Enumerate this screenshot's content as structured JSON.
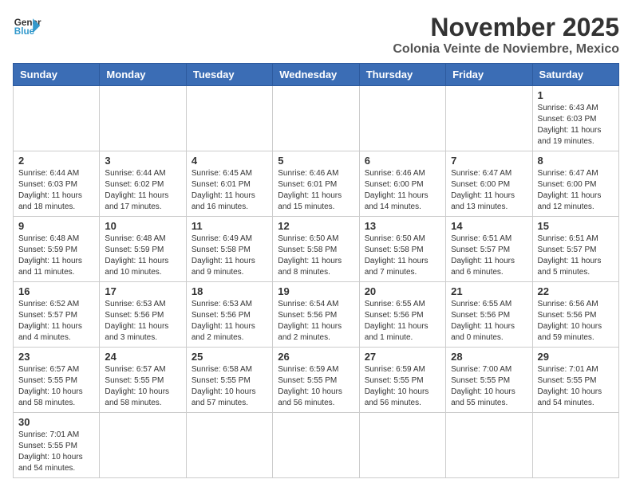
{
  "header": {
    "logo_general": "General",
    "logo_blue": "Blue",
    "month_title": "November 2025",
    "location": "Colonia Veinte de Noviembre, Mexico"
  },
  "days_of_week": [
    "Sunday",
    "Monday",
    "Tuesday",
    "Wednesday",
    "Thursday",
    "Friday",
    "Saturday"
  ],
  "weeks": [
    [
      {
        "day": "",
        "info": ""
      },
      {
        "day": "",
        "info": ""
      },
      {
        "day": "",
        "info": ""
      },
      {
        "day": "",
        "info": ""
      },
      {
        "day": "",
        "info": ""
      },
      {
        "day": "",
        "info": ""
      },
      {
        "day": "1",
        "info": "Sunrise: 6:43 AM\nSunset: 6:03 PM\nDaylight: 11 hours and 19 minutes."
      }
    ],
    [
      {
        "day": "2",
        "info": "Sunrise: 6:44 AM\nSunset: 6:03 PM\nDaylight: 11 hours and 18 minutes."
      },
      {
        "day": "3",
        "info": "Sunrise: 6:44 AM\nSunset: 6:02 PM\nDaylight: 11 hours and 17 minutes."
      },
      {
        "day": "4",
        "info": "Sunrise: 6:45 AM\nSunset: 6:01 PM\nDaylight: 11 hours and 16 minutes."
      },
      {
        "day": "5",
        "info": "Sunrise: 6:46 AM\nSunset: 6:01 PM\nDaylight: 11 hours and 15 minutes."
      },
      {
        "day": "6",
        "info": "Sunrise: 6:46 AM\nSunset: 6:00 PM\nDaylight: 11 hours and 14 minutes."
      },
      {
        "day": "7",
        "info": "Sunrise: 6:47 AM\nSunset: 6:00 PM\nDaylight: 11 hours and 13 minutes."
      },
      {
        "day": "8",
        "info": "Sunrise: 6:47 AM\nSunset: 6:00 PM\nDaylight: 11 hours and 12 minutes."
      }
    ],
    [
      {
        "day": "9",
        "info": "Sunrise: 6:48 AM\nSunset: 5:59 PM\nDaylight: 11 hours and 11 minutes."
      },
      {
        "day": "10",
        "info": "Sunrise: 6:48 AM\nSunset: 5:59 PM\nDaylight: 11 hours and 10 minutes."
      },
      {
        "day": "11",
        "info": "Sunrise: 6:49 AM\nSunset: 5:58 PM\nDaylight: 11 hours and 9 minutes."
      },
      {
        "day": "12",
        "info": "Sunrise: 6:50 AM\nSunset: 5:58 PM\nDaylight: 11 hours and 8 minutes."
      },
      {
        "day": "13",
        "info": "Sunrise: 6:50 AM\nSunset: 5:58 PM\nDaylight: 11 hours and 7 minutes."
      },
      {
        "day": "14",
        "info": "Sunrise: 6:51 AM\nSunset: 5:57 PM\nDaylight: 11 hours and 6 minutes."
      },
      {
        "day": "15",
        "info": "Sunrise: 6:51 AM\nSunset: 5:57 PM\nDaylight: 11 hours and 5 minutes."
      }
    ],
    [
      {
        "day": "16",
        "info": "Sunrise: 6:52 AM\nSunset: 5:57 PM\nDaylight: 11 hours and 4 minutes."
      },
      {
        "day": "17",
        "info": "Sunrise: 6:53 AM\nSunset: 5:56 PM\nDaylight: 11 hours and 3 minutes."
      },
      {
        "day": "18",
        "info": "Sunrise: 6:53 AM\nSunset: 5:56 PM\nDaylight: 11 hours and 2 minutes."
      },
      {
        "day": "19",
        "info": "Sunrise: 6:54 AM\nSunset: 5:56 PM\nDaylight: 11 hours and 2 minutes."
      },
      {
        "day": "20",
        "info": "Sunrise: 6:55 AM\nSunset: 5:56 PM\nDaylight: 11 hours and 1 minute."
      },
      {
        "day": "21",
        "info": "Sunrise: 6:55 AM\nSunset: 5:56 PM\nDaylight: 11 hours and 0 minutes."
      },
      {
        "day": "22",
        "info": "Sunrise: 6:56 AM\nSunset: 5:56 PM\nDaylight: 10 hours and 59 minutes."
      }
    ],
    [
      {
        "day": "23",
        "info": "Sunrise: 6:57 AM\nSunset: 5:55 PM\nDaylight: 10 hours and 58 minutes."
      },
      {
        "day": "24",
        "info": "Sunrise: 6:57 AM\nSunset: 5:55 PM\nDaylight: 10 hours and 58 minutes."
      },
      {
        "day": "25",
        "info": "Sunrise: 6:58 AM\nSunset: 5:55 PM\nDaylight: 10 hours and 57 minutes."
      },
      {
        "day": "26",
        "info": "Sunrise: 6:59 AM\nSunset: 5:55 PM\nDaylight: 10 hours and 56 minutes."
      },
      {
        "day": "27",
        "info": "Sunrise: 6:59 AM\nSunset: 5:55 PM\nDaylight: 10 hours and 56 minutes."
      },
      {
        "day": "28",
        "info": "Sunrise: 7:00 AM\nSunset: 5:55 PM\nDaylight: 10 hours and 55 minutes."
      },
      {
        "day": "29",
        "info": "Sunrise: 7:01 AM\nSunset: 5:55 PM\nDaylight: 10 hours and 54 minutes."
      }
    ],
    [
      {
        "day": "30",
        "info": "Sunrise: 7:01 AM\nSunset: 5:55 PM\nDaylight: 10 hours and 54 minutes."
      },
      {
        "day": "",
        "info": ""
      },
      {
        "day": "",
        "info": ""
      },
      {
        "day": "",
        "info": ""
      },
      {
        "day": "",
        "info": ""
      },
      {
        "day": "",
        "info": ""
      },
      {
        "day": "",
        "info": ""
      }
    ]
  ]
}
